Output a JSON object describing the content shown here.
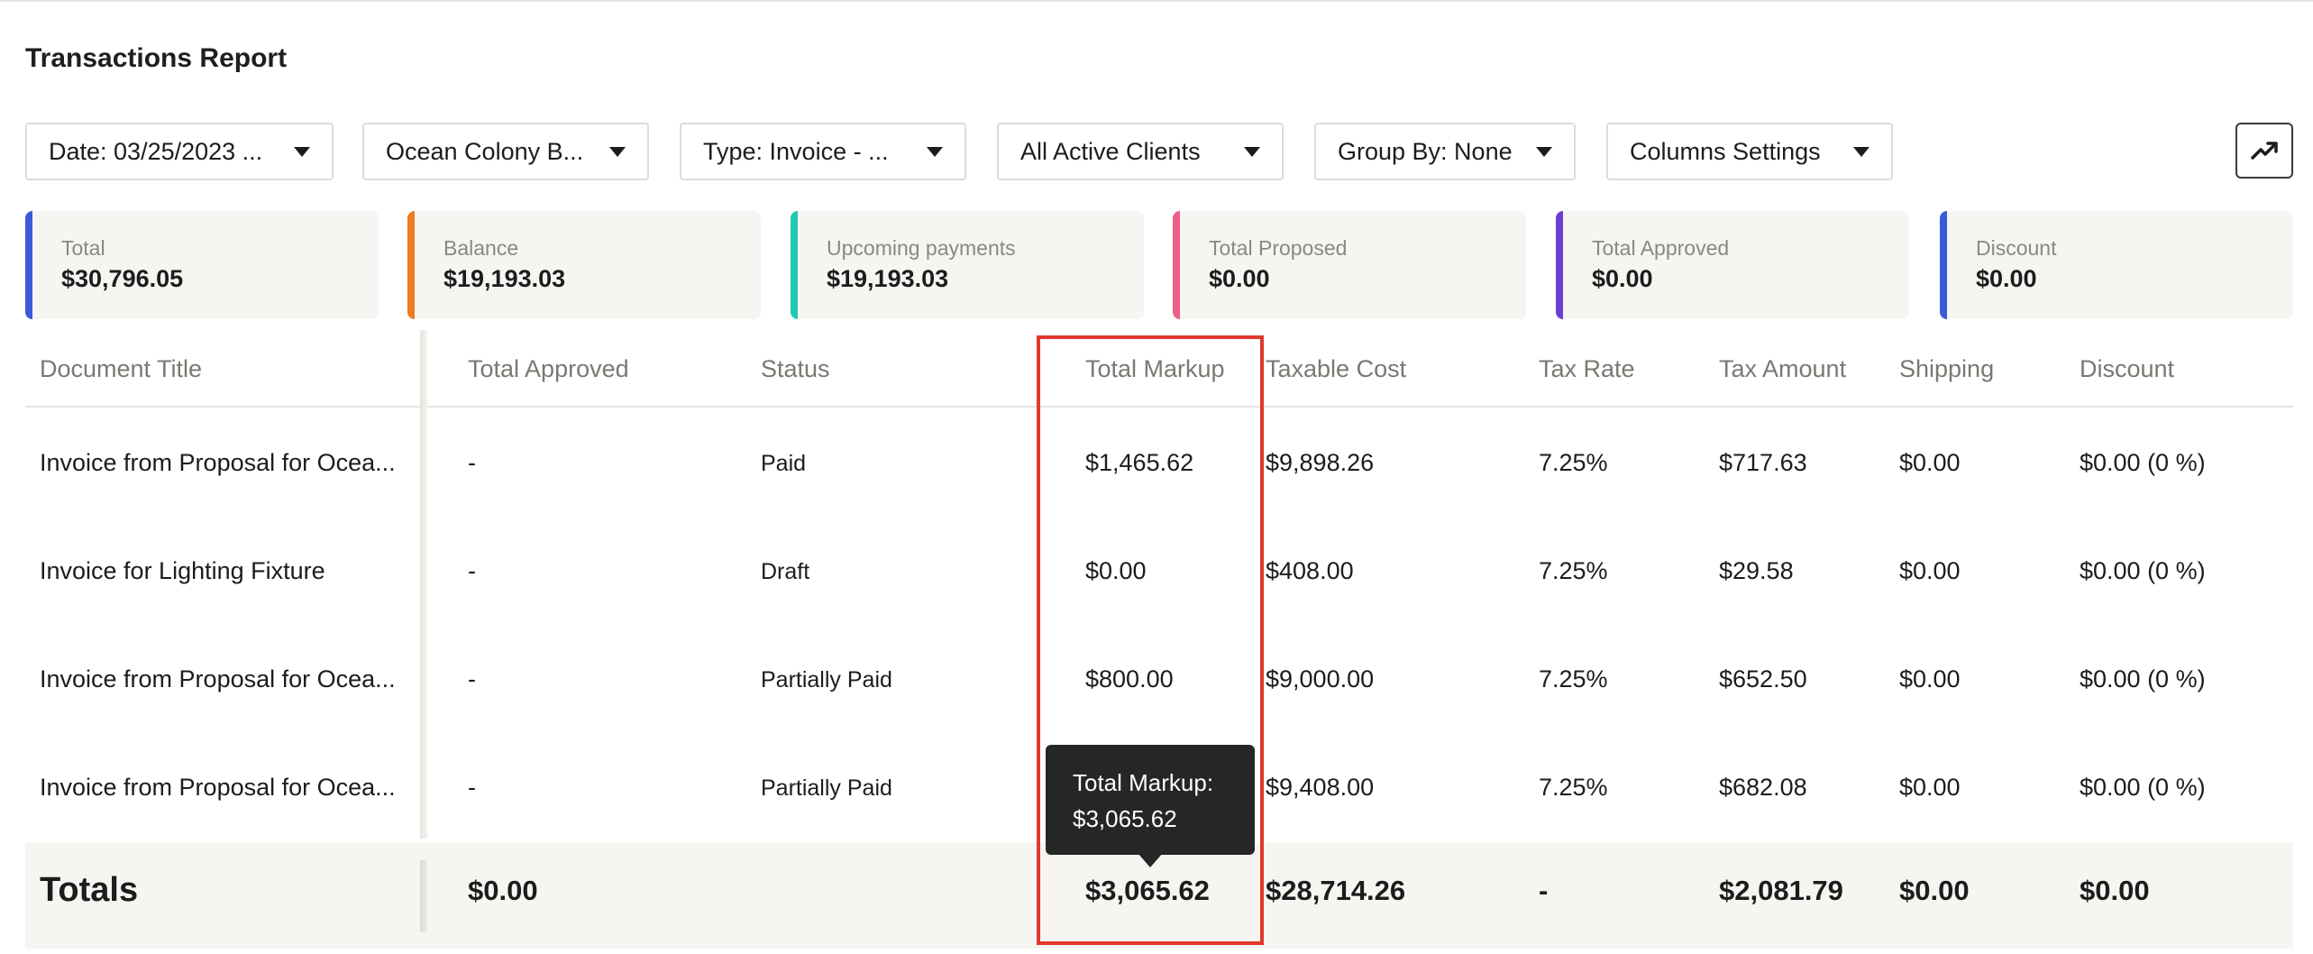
{
  "page_title": "Transactions Report",
  "filters": [
    {
      "label": "Date: 03/25/2023 ..."
    },
    {
      "label": "Ocean Colony B..."
    },
    {
      "label": "Type: Invoice - ..."
    },
    {
      "label": "All Active Clients"
    },
    {
      "label": "Group By: None"
    },
    {
      "label": "Columns Settings"
    }
  ],
  "chart_button_icon": "trending-up-icon",
  "cards": [
    {
      "label": "Total",
      "value": "$30,796.05",
      "color": "#3a5bd9"
    },
    {
      "label": "Balance",
      "value": "$19,193.03",
      "color": "#f07a22"
    },
    {
      "label": "Upcoming payments",
      "value": "$19,193.03",
      "color": "#1fc9b0"
    },
    {
      "label": "Total Proposed",
      "value": "$0.00",
      "color": "#ee5f88"
    },
    {
      "label": "Total Approved",
      "value": "$0.00",
      "color": "#6a3fd1"
    },
    {
      "label": "Discount",
      "value": "$0.00",
      "color": "#3a5bd9"
    }
  ],
  "table": {
    "columns": [
      "Document Title",
      "Total Approved",
      "Status",
      "Total Markup",
      "Taxable Cost",
      "Tax Rate",
      "Tax Amount",
      "Shipping",
      "Discount"
    ],
    "rows": [
      {
        "title": "Invoice from Proposal for Ocea...",
        "approved": "-",
        "status": "Paid",
        "markup": "$1,465.62",
        "taxable": "$9,898.26",
        "rate": "7.25%",
        "tax": "$717.63",
        "shipping": "$0.00",
        "discount": "$0.00 (0 %)"
      },
      {
        "title": "Invoice for Lighting Fixture",
        "approved": "-",
        "status": "Draft",
        "markup": "$0.00",
        "taxable": "$408.00",
        "rate": "7.25%",
        "tax": "$29.58",
        "shipping": "$0.00",
        "discount": "$0.00 (0 %)"
      },
      {
        "title": "Invoice from Proposal for Ocea...",
        "approved": "-",
        "status": "Partially Paid",
        "markup": "$800.00",
        "taxable": "$9,000.00",
        "rate": "7.25%",
        "tax": "$652.50",
        "shipping": "$0.00",
        "discount": "$0.00 (0 %)"
      },
      {
        "title": "Invoice from Proposal for Ocea...",
        "approved": "-",
        "status": "Partially Paid",
        "markup": "",
        "taxable": "$9,408.00",
        "rate": "7.25%",
        "tax": "$682.08",
        "shipping": "$0.00",
        "discount": "$0.00 (0 %)"
      }
    ],
    "totals": {
      "label": "Totals",
      "approved": "$0.00",
      "markup": "$3,065.62",
      "taxable": "$28,714.26",
      "rate": "-",
      "tax": "$2,081.79",
      "shipping": "$0.00",
      "discount": "$0.00"
    }
  },
  "tooltip": {
    "line1": "Total Markup:",
    "line2": "$3,065.62"
  },
  "highlight_color": "#e0392b"
}
